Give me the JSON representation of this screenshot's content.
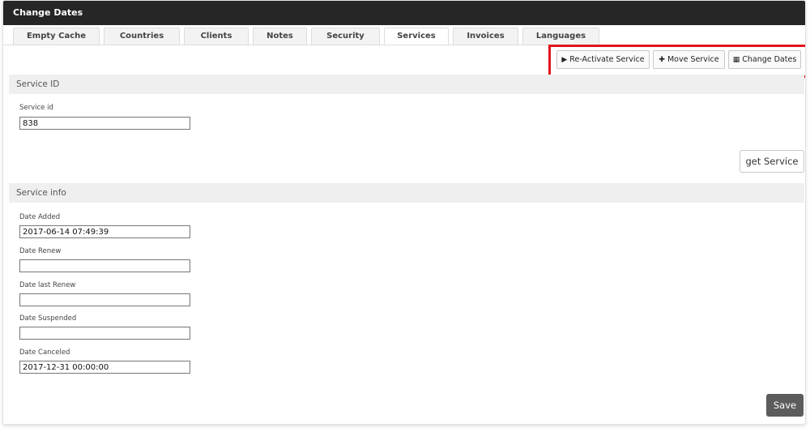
{
  "window": {
    "title": "Change Dates"
  },
  "tabs": [
    {
      "label": "Empty Cache"
    },
    {
      "label": "Countries"
    },
    {
      "label": "Clients"
    },
    {
      "label": "Notes"
    },
    {
      "label": "Security"
    },
    {
      "label": "Services",
      "active": true
    },
    {
      "label": "Invoices"
    },
    {
      "label": "Languages"
    }
  ],
  "toolbar": {
    "reactivate_label": "Re-Activate Service",
    "move_label": "Move Service",
    "change_dates_label": "Change Dates",
    "highlight_color": "#e0141e"
  },
  "service_id_section": {
    "title": "Service ID",
    "field_label": "Service id",
    "field_value": "838",
    "get_button": "get Service"
  },
  "service_info_section": {
    "title": "Service info",
    "fields": [
      {
        "label": "Date Added",
        "value": "2017-06-14 07:49:39"
      },
      {
        "label": "Date Renew",
        "value": ""
      },
      {
        "label": "Date last Renew",
        "value": ""
      },
      {
        "label": "Date Suspended",
        "value": ""
      },
      {
        "label": "Date Canceled",
        "value": "2017-12-31 00:00:00"
      }
    ]
  },
  "save_button": "Save"
}
